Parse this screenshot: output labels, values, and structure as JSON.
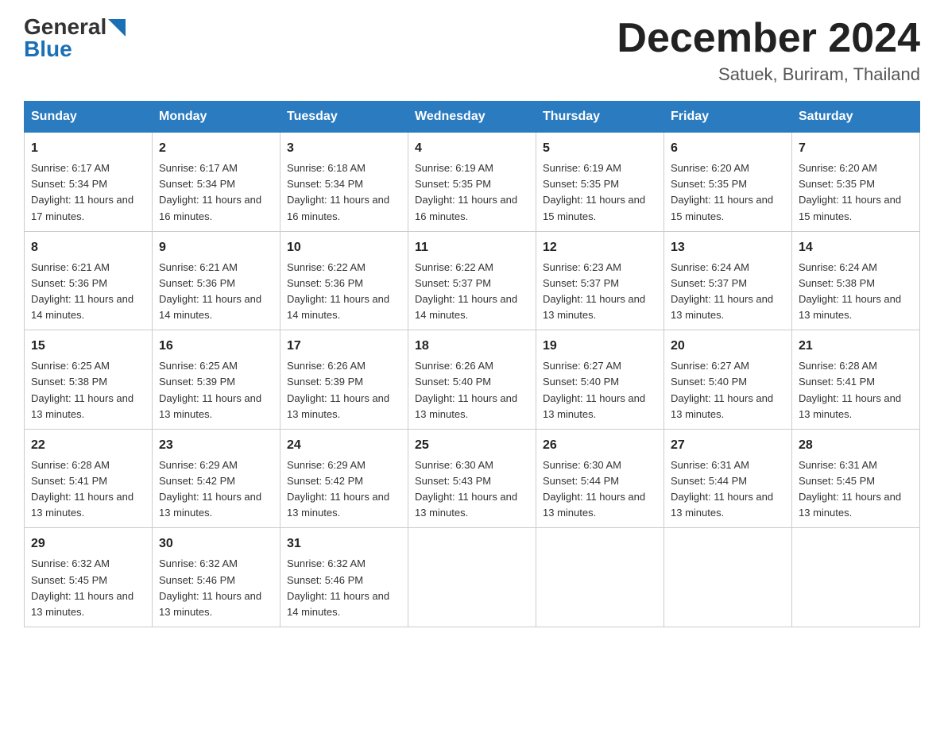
{
  "header": {
    "logo_general": "General",
    "logo_blue": "Blue",
    "month_title": "December 2024",
    "location": "Satuek, Buriram, Thailand"
  },
  "columns": [
    "Sunday",
    "Monday",
    "Tuesday",
    "Wednesday",
    "Thursday",
    "Friday",
    "Saturday"
  ],
  "weeks": [
    [
      {
        "day": "1",
        "sunrise": "6:17 AM",
        "sunset": "5:34 PM",
        "daylight": "11 hours and 17 minutes."
      },
      {
        "day": "2",
        "sunrise": "6:17 AM",
        "sunset": "5:34 PM",
        "daylight": "11 hours and 16 minutes."
      },
      {
        "day": "3",
        "sunrise": "6:18 AM",
        "sunset": "5:34 PM",
        "daylight": "11 hours and 16 minutes."
      },
      {
        "day": "4",
        "sunrise": "6:19 AM",
        "sunset": "5:35 PM",
        "daylight": "11 hours and 16 minutes."
      },
      {
        "day": "5",
        "sunrise": "6:19 AM",
        "sunset": "5:35 PM",
        "daylight": "11 hours and 15 minutes."
      },
      {
        "day": "6",
        "sunrise": "6:20 AM",
        "sunset": "5:35 PM",
        "daylight": "11 hours and 15 minutes."
      },
      {
        "day": "7",
        "sunrise": "6:20 AM",
        "sunset": "5:35 PM",
        "daylight": "11 hours and 15 minutes."
      }
    ],
    [
      {
        "day": "8",
        "sunrise": "6:21 AM",
        "sunset": "5:36 PM",
        "daylight": "11 hours and 14 minutes."
      },
      {
        "day": "9",
        "sunrise": "6:21 AM",
        "sunset": "5:36 PM",
        "daylight": "11 hours and 14 minutes."
      },
      {
        "day": "10",
        "sunrise": "6:22 AM",
        "sunset": "5:36 PM",
        "daylight": "11 hours and 14 minutes."
      },
      {
        "day": "11",
        "sunrise": "6:22 AM",
        "sunset": "5:37 PM",
        "daylight": "11 hours and 14 minutes."
      },
      {
        "day": "12",
        "sunrise": "6:23 AM",
        "sunset": "5:37 PM",
        "daylight": "11 hours and 13 minutes."
      },
      {
        "day": "13",
        "sunrise": "6:24 AM",
        "sunset": "5:37 PM",
        "daylight": "11 hours and 13 minutes."
      },
      {
        "day": "14",
        "sunrise": "6:24 AM",
        "sunset": "5:38 PM",
        "daylight": "11 hours and 13 minutes."
      }
    ],
    [
      {
        "day": "15",
        "sunrise": "6:25 AM",
        "sunset": "5:38 PM",
        "daylight": "11 hours and 13 minutes."
      },
      {
        "day": "16",
        "sunrise": "6:25 AM",
        "sunset": "5:39 PM",
        "daylight": "11 hours and 13 minutes."
      },
      {
        "day": "17",
        "sunrise": "6:26 AM",
        "sunset": "5:39 PM",
        "daylight": "11 hours and 13 minutes."
      },
      {
        "day": "18",
        "sunrise": "6:26 AM",
        "sunset": "5:40 PM",
        "daylight": "11 hours and 13 minutes."
      },
      {
        "day": "19",
        "sunrise": "6:27 AM",
        "sunset": "5:40 PM",
        "daylight": "11 hours and 13 minutes."
      },
      {
        "day": "20",
        "sunrise": "6:27 AM",
        "sunset": "5:40 PM",
        "daylight": "11 hours and 13 minutes."
      },
      {
        "day": "21",
        "sunrise": "6:28 AM",
        "sunset": "5:41 PM",
        "daylight": "11 hours and 13 minutes."
      }
    ],
    [
      {
        "day": "22",
        "sunrise": "6:28 AM",
        "sunset": "5:41 PM",
        "daylight": "11 hours and 13 minutes."
      },
      {
        "day": "23",
        "sunrise": "6:29 AM",
        "sunset": "5:42 PM",
        "daylight": "11 hours and 13 minutes."
      },
      {
        "day": "24",
        "sunrise": "6:29 AM",
        "sunset": "5:42 PM",
        "daylight": "11 hours and 13 minutes."
      },
      {
        "day": "25",
        "sunrise": "6:30 AM",
        "sunset": "5:43 PM",
        "daylight": "11 hours and 13 minutes."
      },
      {
        "day": "26",
        "sunrise": "6:30 AM",
        "sunset": "5:44 PM",
        "daylight": "11 hours and 13 minutes."
      },
      {
        "day": "27",
        "sunrise": "6:31 AM",
        "sunset": "5:44 PM",
        "daylight": "11 hours and 13 minutes."
      },
      {
        "day": "28",
        "sunrise": "6:31 AM",
        "sunset": "5:45 PM",
        "daylight": "11 hours and 13 minutes."
      }
    ],
    [
      {
        "day": "29",
        "sunrise": "6:32 AM",
        "sunset": "5:45 PM",
        "daylight": "11 hours and 13 minutes."
      },
      {
        "day": "30",
        "sunrise": "6:32 AM",
        "sunset": "5:46 PM",
        "daylight": "11 hours and 13 minutes."
      },
      {
        "day": "31",
        "sunrise": "6:32 AM",
        "sunset": "5:46 PM",
        "daylight": "11 hours and 14 minutes."
      },
      null,
      null,
      null,
      null
    ]
  ]
}
